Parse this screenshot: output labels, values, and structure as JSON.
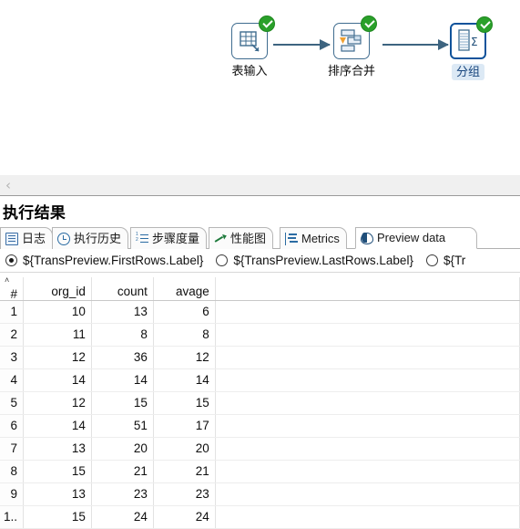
{
  "canvas": {
    "steps": [
      {
        "label": "表输入",
        "icon": "table-input-icon",
        "status": "ok",
        "selected": false
      },
      {
        "label": "排序合并",
        "icon": "sorted-merge-icon",
        "status": "ok",
        "selected": false
      },
      {
        "label": "分组",
        "icon": "group-by-icon",
        "status": "ok",
        "selected": true
      }
    ],
    "connector_icon": "arrow-right-icon",
    "status_icon": "check-circle-icon",
    "accent_color": "#3d6480",
    "status_color": "#2aa02a",
    "selection_color": "#10539b"
  },
  "collapse_bar": {
    "icon": "chevron-left-icon",
    "glyph": "‹"
  },
  "results": {
    "title": "执行结果",
    "tabs": [
      {
        "label": "日志",
        "icon": "log-icon",
        "active": false
      },
      {
        "label": "执行历史",
        "icon": "clock-icon",
        "active": false
      },
      {
        "label": "步骤度量",
        "icon": "numbered-list-icon",
        "active": false
      },
      {
        "label": "性能图",
        "icon": "line-chart-icon",
        "active": false
      },
      {
        "label": "Metrics",
        "icon": "metrics-icon",
        "active": false
      },
      {
        "label": "Preview data",
        "icon": "eye-icon",
        "active": true
      }
    ],
    "radios": [
      {
        "label": "${TransPreview.FirstRows.Label}",
        "selected": true
      },
      {
        "label": "${TransPreview.LastRows.Label}",
        "selected": false
      },
      {
        "label": "${Tr",
        "selected": false
      }
    ]
  },
  "table": {
    "sort_indicator": "˄",
    "index_header": "#",
    "columns": [
      "org_id",
      "count",
      "avage"
    ],
    "rows": [
      {
        "n": "1",
        "org_id": "10",
        "count": "13",
        "avage": "6"
      },
      {
        "n": "2",
        "org_id": "11",
        "count": "8",
        "avage": "8"
      },
      {
        "n": "3",
        "org_id": "12",
        "count": "36",
        "avage": "12"
      },
      {
        "n": "4",
        "org_id": "14",
        "count": "14",
        "avage": "14"
      },
      {
        "n": "5",
        "org_id": "12",
        "count": "15",
        "avage": "15"
      },
      {
        "n": "6",
        "org_id": "14",
        "count": "51",
        "avage": "17"
      },
      {
        "n": "7",
        "org_id": "13",
        "count": "20",
        "avage": "20"
      },
      {
        "n": "8",
        "org_id": "15",
        "count": "21",
        "avage": "21"
      },
      {
        "n": "9",
        "org_id": "13",
        "count": "23",
        "avage": "23"
      },
      {
        "n": "1..",
        "org_id": "15",
        "count": "24",
        "avage": "24"
      }
    ]
  }
}
